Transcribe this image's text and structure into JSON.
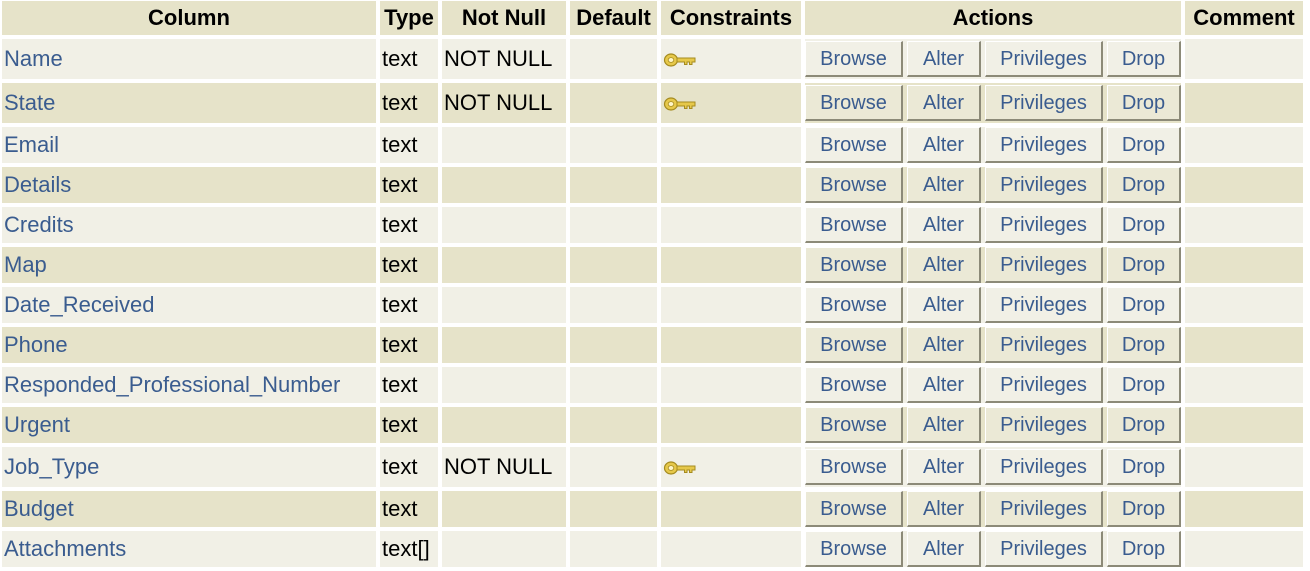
{
  "headers": {
    "column": "Column",
    "type": "Type",
    "not_null": "Not Null",
    "default": "Default",
    "constraints": "Constraints",
    "actions": "Actions",
    "comment": "Comment"
  },
  "actions": {
    "browse": "Browse",
    "alter": "Alter",
    "privileges": "Privileges",
    "drop": "Drop"
  },
  "icons": {
    "constraint": "key-icon"
  },
  "colors": {
    "header_bg": "#e6e3c9",
    "row_odd_bg": "#f1f0e6",
    "row_even_bg": "#e6e3c9",
    "link": "#3a5c8f",
    "key": "#e6c84a"
  },
  "rows": [
    {
      "name": "Name",
      "type": "text",
      "not_null": "NOT NULL",
      "default": "",
      "key": true,
      "comment": ""
    },
    {
      "name": "State",
      "type": "text",
      "not_null": "NOT NULL",
      "default": "",
      "key": true,
      "comment": ""
    },
    {
      "name": "Email",
      "type": "text",
      "not_null": "",
      "default": "",
      "key": false,
      "comment": ""
    },
    {
      "name": "Details",
      "type": "text",
      "not_null": "",
      "default": "",
      "key": false,
      "comment": ""
    },
    {
      "name": "Credits",
      "type": "text",
      "not_null": "",
      "default": "",
      "key": false,
      "comment": ""
    },
    {
      "name": "Map",
      "type": "text",
      "not_null": "",
      "default": "",
      "key": false,
      "comment": ""
    },
    {
      "name": "Date_Received",
      "type": "text",
      "not_null": "",
      "default": "",
      "key": false,
      "comment": ""
    },
    {
      "name": "Phone",
      "type": "text",
      "not_null": "",
      "default": "",
      "key": false,
      "comment": ""
    },
    {
      "name": "Responded_Professional_Number",
      "type": "text",
      "not_null": "",
      "default": "",
      "key": false,
      "comment": ""
    },
    {
      "name": "Urgent",
      "type": "text",
      "not_null": "",
      "default": "",
      "key": false,
      "comment": ""
    },
    {
      "name": "Job_Type",
      "type": "text",
      "not_null": "NOT NULL",
      "default": "",
      "key": true,
      "comment": ""
    },
    {
      "name": "Budget",
      "type": "text",
      "not_null": "",
      "default": "",
      "key": false,
      "comment": ""
    },
    {
      "name": "Attachments",
      "type": "text[]",
      "not_null": "",
      "default": "",
      "key": false,
      "comment": ""
    }
  ]
}
